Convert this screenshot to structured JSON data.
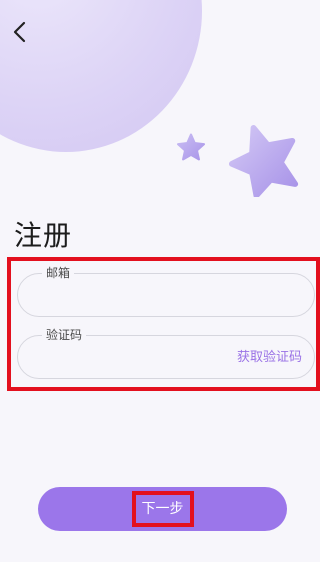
{
  "header": {
    "back_icon": "chevron-left-icon"
  },
  "page": {
    "title": "注册"
  },
  "form": {
    "email_label": "邮箱",
    "email_value": "",
    "code_label": "验证码",
    "code_value": "",
    "get_code_link": "获取验证码"
  },
  "footer": {
    "next_button_label": "下一步"
  },
  "colors": {
    "accent": "#9b76ea",
    "link": "#9a72e6",
    "highlight_box": "#e3101e",
    "background": "#f7f6fb",
    "decor": "#d6ccf4"
  }
}
